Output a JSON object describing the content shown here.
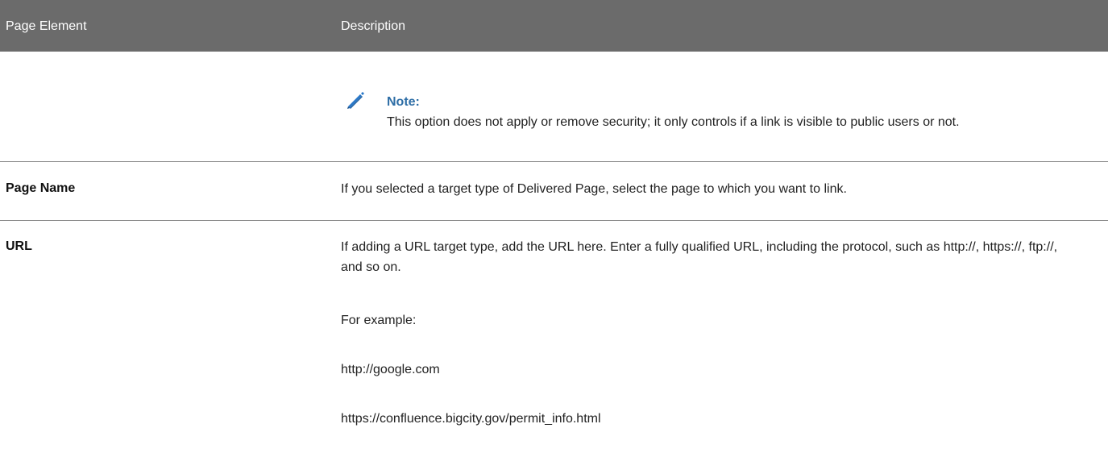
{
  "table": {
    "header": {
      "element": "Page Element",
      "description": "Description"
    }
  },
  "note": {
    "icon": "pencil-icon",
    "title": "Note:",
    "text": "This option does not apply or remove security; it only controls if a link is visible to public users or not."
  },
  "rows": [
    {
      "label": "Page Name",
      "description": "If you selected a target type of Delivered Page, select the page to which you want to link."
    },
    {
      "label": "URL",
      "description": "If adding a URL target type, add the URL here. Enter a fully qualified URL, including the protocol, such as http://, https://, ftp://, and so on.",
      "example_intro": "For example:",
      "example_1": "http://google.com",
      "example_2": "https://confluence.bigcity.gov/permit_info.html"
    }
  ],
  "colors": {
    "header_bg": "#6b6b6b",
    "note_title": "#2e6ea6",
    "icon": "#2a78c8"
  }
}
